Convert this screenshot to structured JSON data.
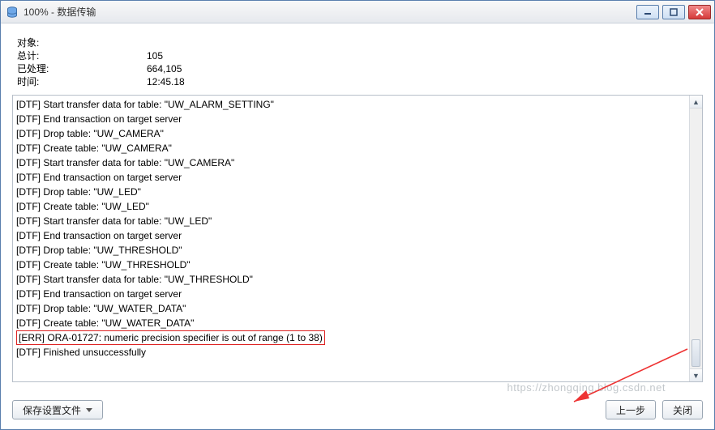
{
  "window": {
    "title": "100% - 数据传输",
    "icon_name": "database-icon"
  },
  "summary": {
    "labels": {
      "object": "对象:",
      "total": "总计:",
      "processed": "已处理:",
      "time": "时间:"
    },
    "values": {
      "object": "",
      "total": "105",
      "processed": "664,105",
      "time": "12:45.18"
    }
  },
  "log_lines": [
    "[DTF] Start transfer data for table: \"UW_ALARM_SETTING\"",
    "[DTF] End transaction on target server",
    "[DTF] Drop table: \"UW_CAMERA\"",
    "[DTF] Create table: \"UW_CAMERA\"",
    "[DTF] Start transfer data for table: \"UW_CAMERA\"",
    "[DTF] End transaction on target server",
    "[DTF] Drop table: \"UW_LED\"",
    "[DTF] Create table: \"UW_LED\"",
    "[DTF] Start transfer data for table: \"UW_LED\"",
    "[DTF] End transaction on target server",
    "[DTF] Drop table: \"UW_THRESHOLD\"",
    "[DTF] Create table: \"UW_THRESHOLD\"",
    "[DTF] Start transfer data for table: \"UW_THRESHOLD\"",
    "[DTF] End transaction on target server",
    "[DTF] Drop table: \"UW_WATER_DATA\"",
    "[DTF] Create table: \"UW_WATER_DATA\""
  ],
  "log_error": "[ERR] ORA-01727: numeric precision specifier is out of range (1 to 38)",
  "log_final": "[DTF] Finished unsuccessfully",
  "buttons": {
    "save_settings": "保存设置文件",
    "prev": "上一步",
    "close": "关闭"
  },
  "watermark": "https://zhongqing.blog.csdn.net"
}
